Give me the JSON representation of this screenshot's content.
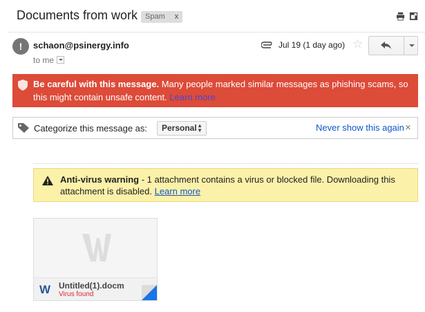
{
  "subject": {
    "title": "Documents from work",
    "label": "Spam",
    "label_remove": "x"
  },
  "header_icons": [
    "print-icon",
    "new-window-icon"
  ],
  "message": {
    "sender": "schaon@psinergy.info",
    "to": "to me",
    "date": "Jul 19 (1 day ago)",
    "star": "☆"
  },
  "phishing_banner": {
    "bold": "Be careful with this message.",
    "text": " Many people marked similar messages as phishing scams, so this might contain unsafe content.",
    "link": "Learn more",
    "bg_color": "#dd4b39"
  },
  "categorize": {
    "label": "Categorize this message as:",
    "selected": "Personal",
    "never_show": "Never show this again",
    "close": "×"
  },
  "antivirus": {
    "bold": "Anti-virus warning",
    "text": " - 1 attachment contains a virus or blocked file. Downloading this attachment is disabled.",
    "link": "Learn more",
    "bg_color": "#fbf1a9"
  },
  "attachment": {
    "icon_letter": "W",
    "filename": "Untitled(1).docm",
    "status": "Virus found",
    "accent": "#1a73e8"
  }
}
